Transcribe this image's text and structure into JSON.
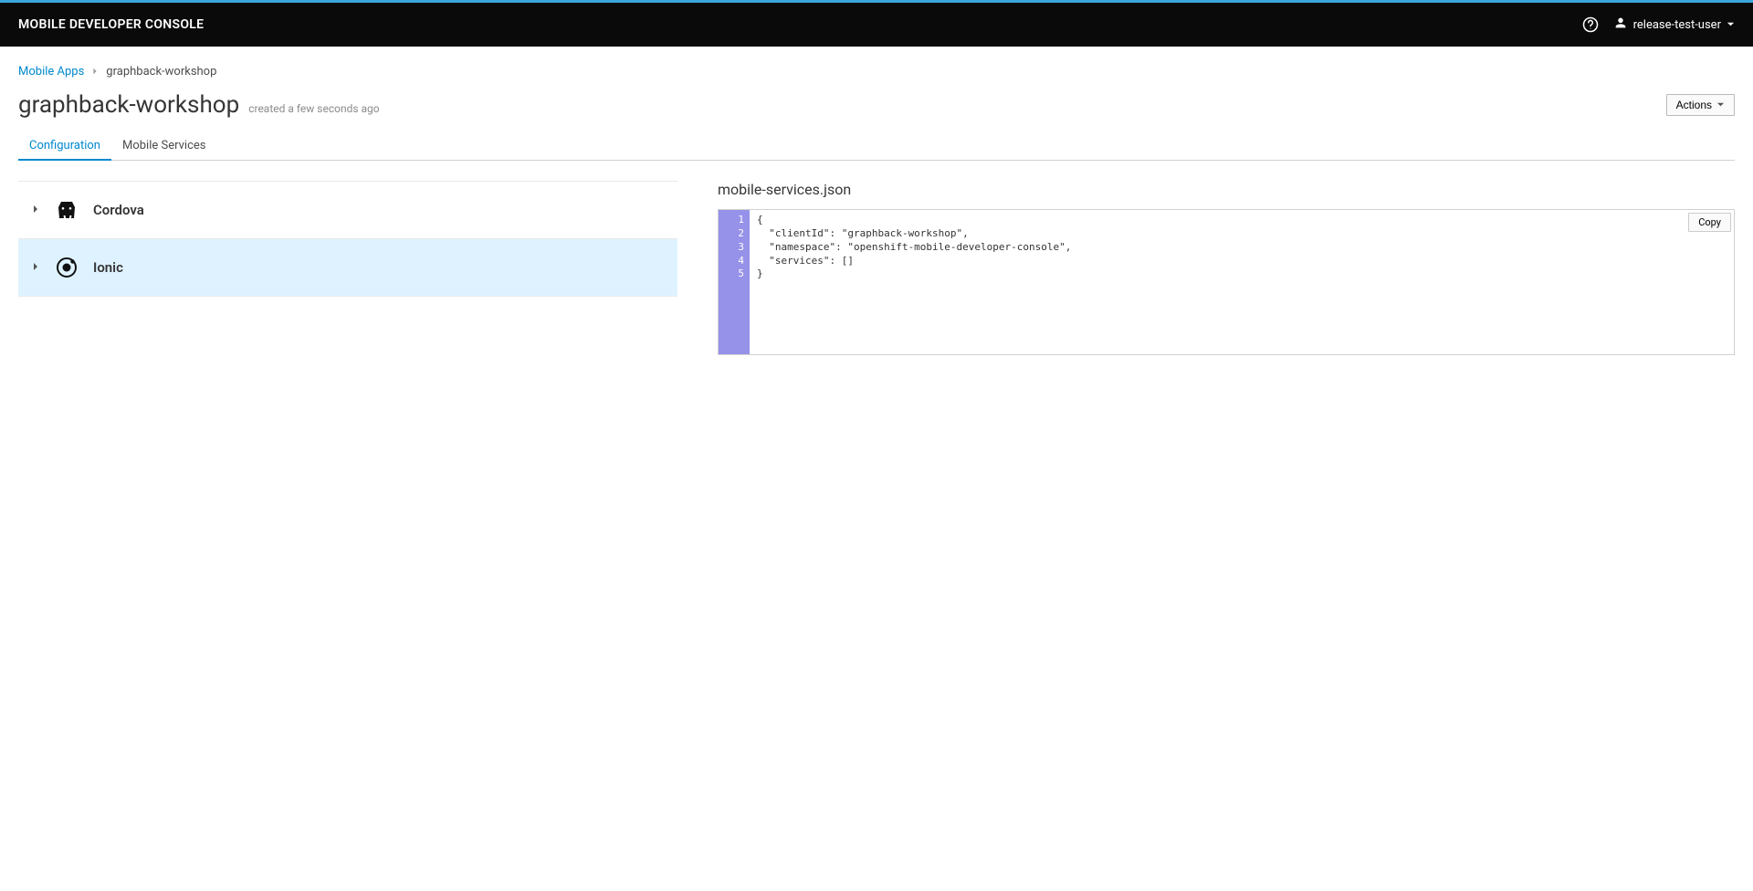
{
  "header": {
    "title": "MOBILE DEVELOPER CONSOLE",
    "user": "release-test-user"
  },
  "breadcrumb": {
    "root": "Mobile Apps",
    "current": "graphback-workshop"
  },
  "page": {
    "title": "graphback-workshop",
    "subtitle": "created a few seconds ago",
    "actions_label": "Actions"
  },
  "tabs": {
    "configuration": "Configuration",
    "mobile_services": "Mobile Services"
  },
  "platforms": [
    {
      "name": "Cordova",
      "highlight": false
    },
    {
      "name": "Ionic",
      "highlight": true
    }
  ],
  "json_panel": {
    "title": "mobile-services.json",
    "copy_label": "Copy",
    "lines": [
      "1",
      "2",
      "3",
      "4",
      "5"
    ],
    "code": "{\n  \"clientId\": \"graphback-workshop\",\n  \"namespace\": \"openshift-mobile-developer-console\",\n  \"services\": []\n}"
  }
}
